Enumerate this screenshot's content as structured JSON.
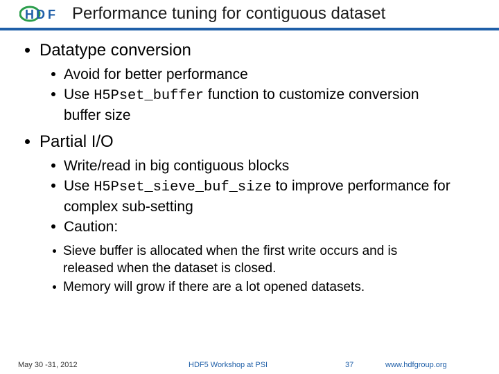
{
  "title": "Performance tuning for contiguous dataset",
  "bullets": {
    "b0": "Datatype conversion",
    "b0s0": "Avoid for better performance",
    "b0s1_pre": "Use ",
    "b0s1_code": "H5Pset_buffer",
    "b0s1_post": " function to customize conversion buffer size",
    "b1": "Partial I/O",
    "b1s0": "Write/read in big contiguous blocks",
    "b1s1_pre": "Use ",
    "b1s1_code": "H5Pset_sieve_buf_size",
    "b1s1_post": "  to improve performance for complex sub-setting",
    "b1s2": "Caution:",
    "b1s2s0": "Sieve buffer is allocated when the first write occurs and is released when the dataset is closed.",
    "b1s2s1": "Memory will grow if there are a lot opened datasets."
  },
  "footer": {
    "date": "May 30 -31, 2012",
    "event": "HDF5 Workshop at PSI",
    "page": "37",
    "url": "www.hdfgroup.org"
  }
}
